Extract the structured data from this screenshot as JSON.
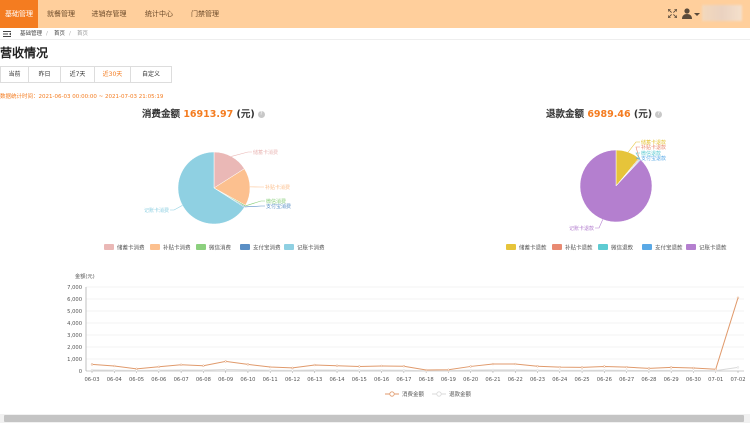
{
  "nav": {
    "tabs": [
      "基础管理",
      "就餐管理",
      "进销存管理",
      "统计中心",
      "门禁管理"
    ],
    "active_index": 0
  },
  "breadcrumb": [
    "基础管理",
    "首页",
    "首页"
  ],
  "page_title": "营收情况",
  "date_tabs": [
    "当前",
    "昨日",
    "近7天",
    "近30天",
    "自定义"
  ],
  "active_date_tab": 3,
  "stat_time": "数据统计时间：2021-06-03 00:00:00 ~ 2021-07-03 21:05:19",
  "consume": {
    "title_prefix": "消费金额 ",
    "amount": "16913.97",
    "unit": " (元)"
  },
  "refund": {
    "title_prefix": "退款金额 ",
    "amount": "6989.46",
    "unit": " (元)"
  },
  "help_glyph": "?",
  "chart_data": [
    {
      "type": "pie",
      "name": "consume-pie",
      "labels": [
        "储蓄卡消费",
        "补贴卡消费",
        "微信消费",
        "支付宝消费",
        "记账卡消费"
      ],
      "values": [
        16,
        17,
        0.6,
        0.4,
        66
      ],
      "colors": [
        "#eab8b6",
        "#fcc08f",
        "#8cd07e",
        "#5a8fc5",
        "#8fd0e2"
      ]
    },
    {
      "type": "pie",
      "name": "refund-pie",
      "labels": [
        "储蓄卡退款",
        "补贴卡退款",
        "微信退款",
        "支付宝退款",
        "记账卡退款"
      ],
      "values": [
        11,
        0.4,
        0.3,
        0.3,
        88
      ],
      "colors": [
        "#e6c43a",
        "#e98a72",
        "#5dcbd2",
        "#5aa9e6",
        "#b47fcf"
      ]
    },
    {
      "type": "line",
      "name": "revenue-trend",
      "ylabel": "金额(元)",
      "ylim": [
        0,
        7000
      ],
      "yticks": [
        "0",
        "1,000",
        "2,000",
        "3,000",
        "4,000",
        "5,000",
        "6,000",
        "7,000"
      ],
      "x": [
        "06-03",
        "06-04",
        "06-05",
        "06-06",
        "06-07",
        "06-08",
        "06-09",
        "06-10",
        "06-11",
        "06-12",
        "06-13",
        "06-14",
        "06-15",
        "06-16",
        "06-17",
        "06-18",
        "06-19",
        "06-20",
        "06-21",
        "06-22",
        "06-23",
        "06-24",
        "06-25",
        "06-26",
        "06-27",
        "06-28",
        "06-29",
        "06-30",
        "07-01",
        "07-02"
      ],
      "series": [
        {
          "name": "消费金额",
          "color": "#e09a6c",
          "values": [
            550,
            420,
            180,
            350,
            520,
            440,
            800,
            550,
            330,
            260,
            500,
            440,
            380,
            420,
            400,
            80,
            100,
            380,
            580,
            580,
            400,
            320,
            300,
            380,
            320,
            220,
            300,
            250,
            150,
            6100
          ]
        },
        {
          "name": "退款金额",
          "color": "#d9d9d9",
          "values": [
            80,
            60,
            40,
            60,
            80,
            70,
            120,
            90,
            60,
            50,
            80,
            70,
            60,
            70,
            60,
            20,
            30,
            70,
            90,
            90,
            60,
            50,
            50,
            60,
            50,
            40,
            50,
            40,
            30,
            300
          ]
        }
      ]
    }
  ]
}
